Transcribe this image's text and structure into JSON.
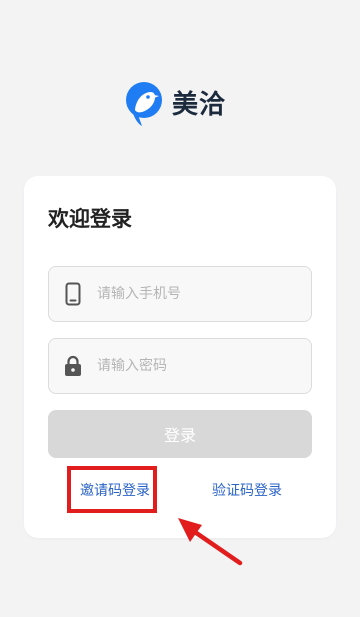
{
  "brand": {
    "name": "美洽",
    "logo_icon": "meiqia-bird-logo-icon",
    "color": "#1f7cf3"
  },
  "login": {
    "title": "欢迎登录",
    "phone": {
      "placeholder": "请输入手机号",
      "value": "",
      "icon": "phone-icon"
    },
    "password": {
      "placeholder": "请输入密码",
      "value": "",
      "icon": "lock-icon"
    },
    "submit_label": "登录",
    "submit_enabled": false
  },
  "links": {
    "invite_login": "邀请码登录",
    "code_login": "验证码登录",
    "link_color": "#2a63c8"
  },
  "annotation": {
    "highlight_color": "#e11d1d",
    "arrow_color": "#e11d1d"
  }
}
